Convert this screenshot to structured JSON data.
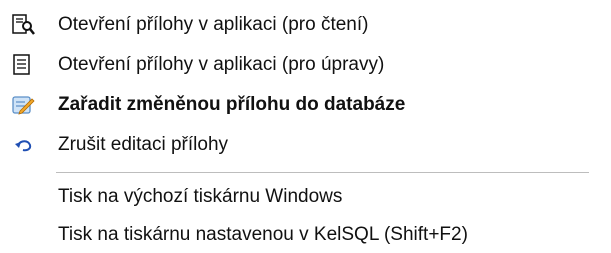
{
  "menu": {
    "items": [
      {
        "label": "Otevření přílohy v aplikaci (pro čtení)",
        "icon": "view-document-icon"
      },
      {
        "label": "Otevření přílohy v aplikaci (pro úpravy)",
        "icon": "edit-document-icon"
      },
      {
        "label": "Zařadit změněnou přílohu do databáze",
        "icon": "save-to-database-icon",
        "emphasis": "bold"
      },
      {
        "label": "Zrušit editaci přílohy",
        "icon": "undo-arrow-icon"
      },
      {
        "label": "Tisk na výchozí tiskárnu Windows"
      },
      {
        "label": "Tisk na tiskárnu nastavenou v KelSQL (Shift+F2)"
      }
    ]
  },
  "colors": {
    "separator": "#bdbdbd",
    "save_icon": "#f2a82b",
    "undo_icon": "#1f4fb3"
  }
}
